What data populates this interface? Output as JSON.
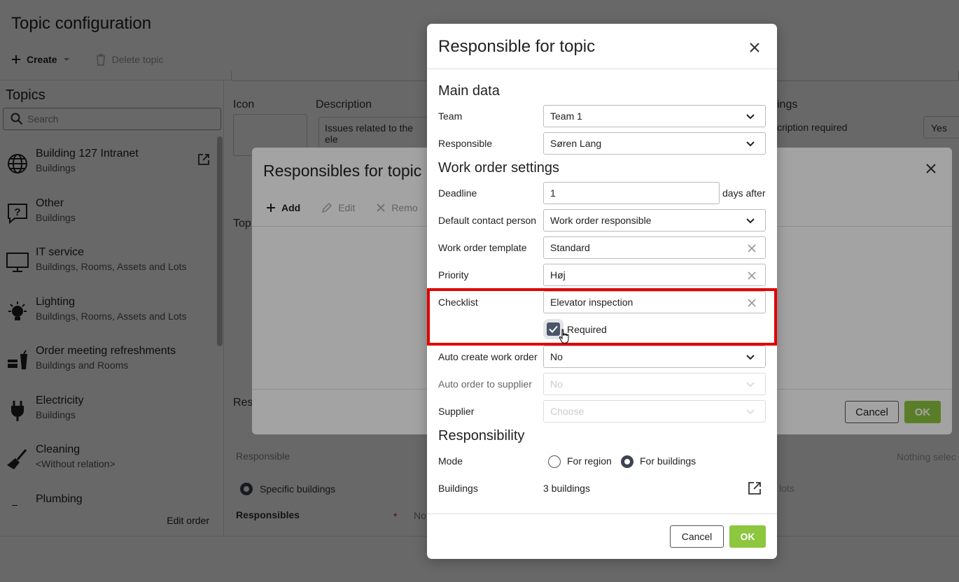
{
  "colors": {
    "accent_green": "#8dc63f",
    "highlight_red": "#e00000",
    "checkbox_dark": "#4a5568"
  },
  "page": {
    "title": "Topic configuration",
    "toolbar": {
      "create": "Create",
      "delete": "Delete topic"
    }
  },
  "topics": {
    "title": "Topics",
    "search_placeholder": "Search",
    "items": [
      {
        "name": "Building 127 Intranet",
        "sub": "Buildings",
        "icon": "globe-icon"
      },
      {
        "name": "Other",
        "sub": "Buildings",
        "icon": "question-bubble-icon"
      },
      {
        "name": "IT service",
        "sub": "Buildings, Rooms, Assets and Lots",
        "icon": "monitor-icon"
      },
      {
        "name": "Lighting",
        "sub": "Buildings, Rooms, Assets and Lots",
        "icon": "lightbulb-icon"
      },
      {
        "name": "Order meeting refreshments",
        "sub": "Buildings and Rooms",
        "icon": "refreshments-icon"
      },
      {
        "name": "Electricity",
        "sub": "Buildings",
        "icon": "plug-icon"
      },
      {
        "name": "Cleaning",
        "sub": "<Without relation>",
        "icon": "broom-icon"
      },
      {
        "name": "Plumbing",
        "sub": "",
        "icon": "faucet-icon"
      }
    ],
    "edit_order": "Edit order"
  },
  "background": {
    "icon_label": "Icon",
    "description_label": "Description",
    "description_value": "Issues related to the ele",
    "settings_label": "ings",
    "description_required": "cription required",
    "yes": "Yes",
    "topic_label": "Top",
    "res_label": "Res",
    "responsible_label": "Responsible",
    "specific_buildings": "Specific buildings",
    "responsibles": "Responsibles",
    "no_label": "No",
    "nothing_selected": "Nothing selec",
    "lots_label": "lots"
  },
  "dialog2": {
    "title": "Responsibles for topic",
    "toolbar": {
      "add": "Add",
      "edit": "Edit",
      "remove": "Remo"
    },
    "cancel": "Cancel",
    "ok": "OK"
  },
  "modal": {
    "title": "Responsible for topic",
    "main_data": {
      "heading": "Main data",
      "team_label": "Team",
      "team_value": "Team 1",
      "responsible_label": "Responsible",
      "responsible_value": "Søren Lang"
    },
    "work_order": {
      "heading": "Work order settings",
      "deadline_label": "Deadline",
      "deadline_value": "1",
      "days_after": "days after",
      "contact_label": "Default contact person",
      "contact_value": "Work order responsible",
      "template_label": "Work order template",
      "template_value": "Standard",
      "priority_label": "Priority",
      "priority_value": "Høj",
      "checklist_label": "Checklist",
      "checklist_value": "Elevator inspection",
      "required_label": "Required",
      "required_checked": true,
      "auto_create_label": "Auto create work order",
      "auto_create_value": "No",
      "auto_order_label": "Auto order to supplier",
      "auto_order_value": "No",
      "supplier_label": "Supplier",
      "supplier_value": "Choose"
    },
    "responsibility": {
      "heading": "Responsibility",
      "mode_label": "Mode",
      "for_region": "For region",
      "for_buildings": "For buildings",
      "selected_mode": "For buildings",
      "buildings_label": "Buildings",
      "buildings_value": "3 buildings"
    },
    "cancel": "Cancel",
    "ok": "OK"
  }
}
